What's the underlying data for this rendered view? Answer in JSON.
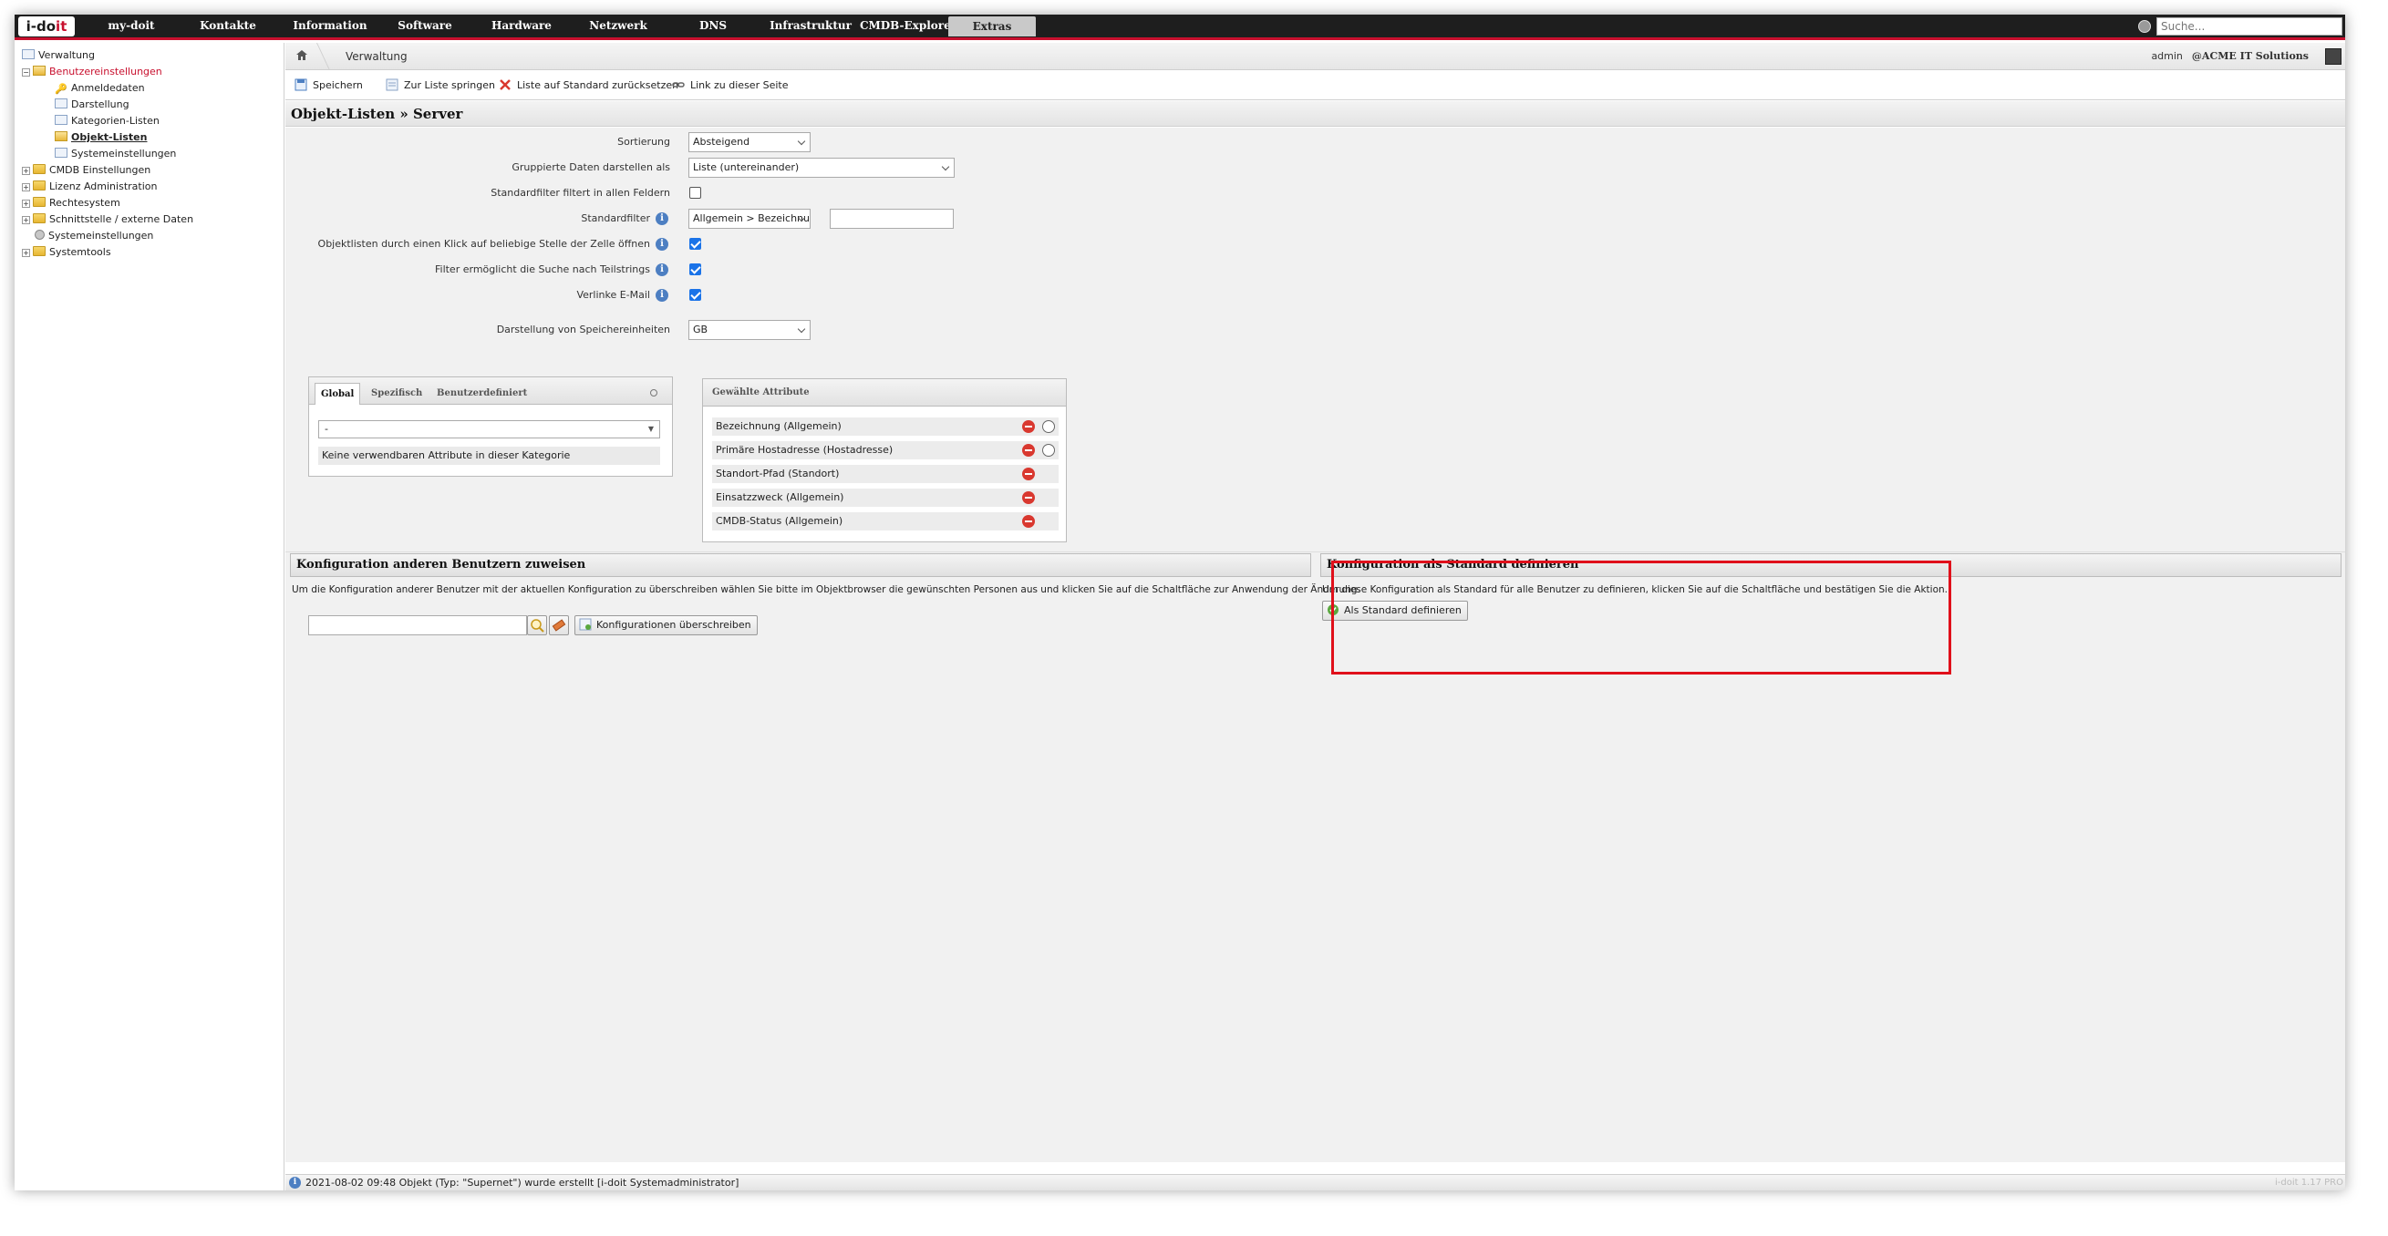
{
  "app": {
    "logo_prefix": "i-do",
    "logo_suffix": "it"
  },
  "nav": {
    "items": [
      "my-doit",
      "Kontakte",
      "Information",
      "Software",
      "Hardware",
      "Netzwerk",
      "DNS",
      "Infrastruktur",
      "CMDB-Explorer",
      "Extras"
    ],
    "active": "Extras",
    "search_placeholder": "Suche..."
  },
  "sidebar": {
    "items": [
      {
        "label": "Verwaltung",
        "icon": "page-icon"
      },
      {
        "label": "Benutzereinstellungen",
        "icon": "folder-open-icon"
      },
      {
        "label": "Anmeldedaten",
        "icon": "key-icon"
      },
      {
        "label": "Darstellung",
        "icon": "page-icon"
      },
      {
        "label": "Kategorien-Listen",
        "icon": "page-icon"
      },
      {
        "label": "Objekt-Listen",
        "icon": "folder-open-icon"
      },
      {
        "label": "Systemeinstellungen",
        "icon": "list-icon"
      },
      {
        "label": "CMDB Einstellungen",
        "icon": "folder-icon"
      },
      {
        "label": "Lizenz Administration",
        "icon": "folder-icon"
      },
      {
        "label": "Rechtesystem",
        "icon": "folder-icon"
      },
      {
        "label": "Schnittstelle / externe Daten",
        "icon": "folder-icon"
      },
      {
        "label": "Systemeinstellungen",
        "icon": "gear-icon"
      },
      {
        "label": "Systemtools",
        "icon": "folder-icon"
      }
    ]
  },
  "header": {
    "breadcrumb": "Verwaltung",
    "user": "admin",
    "org": "@ACME IT Solutions"
  },
  "toolbar": {
    "save": "Speichern",
    "jump_to_list": "Zur Liste springen",
    "reset_list": "Liste auf Standard zurücksetzen",
    "link_page": "Link zu dieser Seite"
  },
  "page_title": "Objekt-Listen » Server",
  "form": {
    "sort_label": "Sortierung",
    "sort_value": "Absteigend",
    "grouped_label": "Gruppierte Daten darstellen als",
    "grouped_value": "Liste (untereinander)",
    "std_filter_all_label": "Standardfilter filtert in allen Feldern",
    "std_filter_all_checked": false,
    "std_filter_label": "Standardfilter",
    "std_filter_value": "Allgemein > Bezeichnung",
    "std_filter_text": "",
    "click_open_label": "Objektlisten durch einen Klick auf beliebige Stelle der Zelle öffnen",
    "click_open_checked": true,
    "substring_label": "Filter ermöglicht die Suche nach Teilstrings",
    "substring_checked": true,
    "email_label": "Verlinke E-Mail",
    "email_checked": true,
    "storage_label": "Darstellung von Speichereinheiten",
    "storage_value": "GB"
  },
  "attributes": {
    "tabs": [
      "Global",
      "Spezifisch",
      "Benutzerdefiniert"
    ],
    "active_tab": "Global",
    "select_value": "-",
    "empty_text": "Keine verwendbaren Attribute in dieser Kategorie",
    "selected_title": "Gewählte Attribute",
    "selected": [
      {
        "label": "Bezeichnung (Allgemein)",
        "radio": true
      },
      {
        "label": "Primäre Hostadresse (Hostadresse)",
        "radio": true
      },
      {
        "label": "Standort-Pfad (Standort)",
        "radio": false
      },
      {
        "label": "Einsatzzweck (Allgemein)",
        "radio": false
      },
      {
        "label": "CMDB-Status (Allgemein)",
        "radio": false
      }
    ]
  },
  "assign_section": {
    "title": "Konfiguration anderen Benutzern zuweisen",
    "text": "Um die Konfiguration anderer Benutzer mit der aktuellen Konfiguration zu überschreiben wählen Sie bitte im Objektbrowser die gewünschten Personen aus und klicken Sie auf die Schaltfläche zur Anwendung der Änderung.",
    "button": "Konfigurationen überschreiben"
  },
  "default_section": {
    "title": "Konfiguration als Standard definieren",
    "text": "Um diese Konfiguration als Standard für alle Benutzer zu definieren, klicken Sie auf die Schaltfläche und bestätigen Sie die Aktion.",
    "button": "Als Standard definieren"
  },
  "status": {
    "text": "2021-08-02 09:48 Objekt (Typ: \"Supernet\") wurde erstellt [i-doit Systemadministrator]",
    "version": "i-doit 1.17 PRO"
  },
  "colors": {
    "accent": "#c8102e",
    "highlight": "#e0101b",
    "nav_bg": "#1e1e1e",
    "info": "#4d7fc2"
  }
}
